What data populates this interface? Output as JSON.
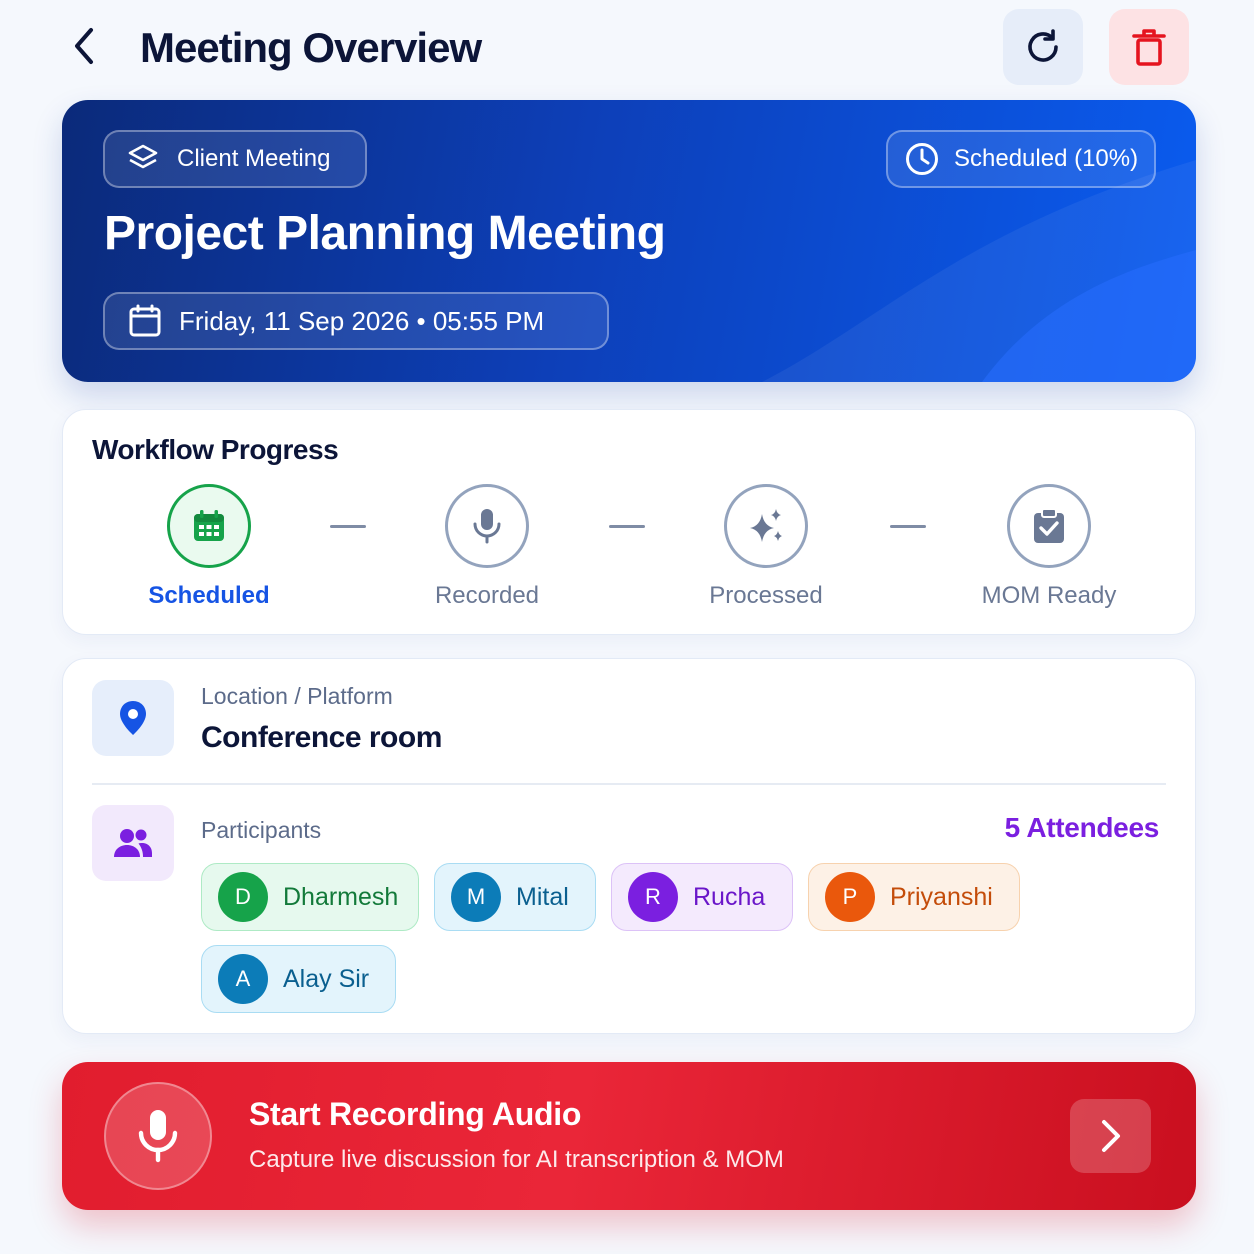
{
  "header": {
    "title": "Meeting Overview",
    "back_icon": "chevron-left-icon",
    "refresh_icon": "refresh-icon",
    "delete_icon": "trash-icon"
  },
  "meeting": {
    "type": "Client Meeting",
    "status": "Scheduled (10%)",
    "progress_percent": 10,
    "title": "Project Planning Meeting",
    "datetime": "Friday, 11 Sep 2026 • 05:55 PM"
  },
  "workflow": {
    "title": "Workflow Progress",
    "steps": [
      {
        "label": "Scheduled",
        "icon": "calendar-icon",
        "active": true
      },
      {
        "label": "Recorded",
        "icon": "microphone-icon",
        "active": false
      },
      {
        "label": "Processed",
        "icon": "sparkles-icon",
        "active": false
      },
      {
        "label": "MOM Ready",
        "icon": "clipboard-check-icon",
        "active": false
      }
    ]
  },
  "location": {
    "label": "Location / Platform",
    "value": "Conference room",
    "icon": "map-pin-icon"
  },
  "participants": {
    "label": "Participants",
    "count_text": "5 Attendees",
    "icon": "users-icon",
    "list": [
      {
        "initial": "D",
        "name": "Dharmesh"
      },
      {
        "initial": "M",
        "name": "Mital"
      },
      {
        "initial": "R",
        "name": "Rucha"
      },
      {
        "initial": "P",
        "name": "Priyanshi"
      },
      {
        "initial": "A",
        "name": "Alay Sir"
      }
    ]
  },
  "record": {
    "title": "Start Recording Audio",
    "subtitle": "Capture live discussion for AI transcription & MOM",
    "icon": "microphone-icon",
    "arrow_icon": "chevron-right-icon"
  },
  "colors": {
    "primary_blue": "#1654e4",
    "success_green": "#16a34a",
    "accent_purple": "#7b1fe0",
    "record_red": "#e11d2e"
  }
}
